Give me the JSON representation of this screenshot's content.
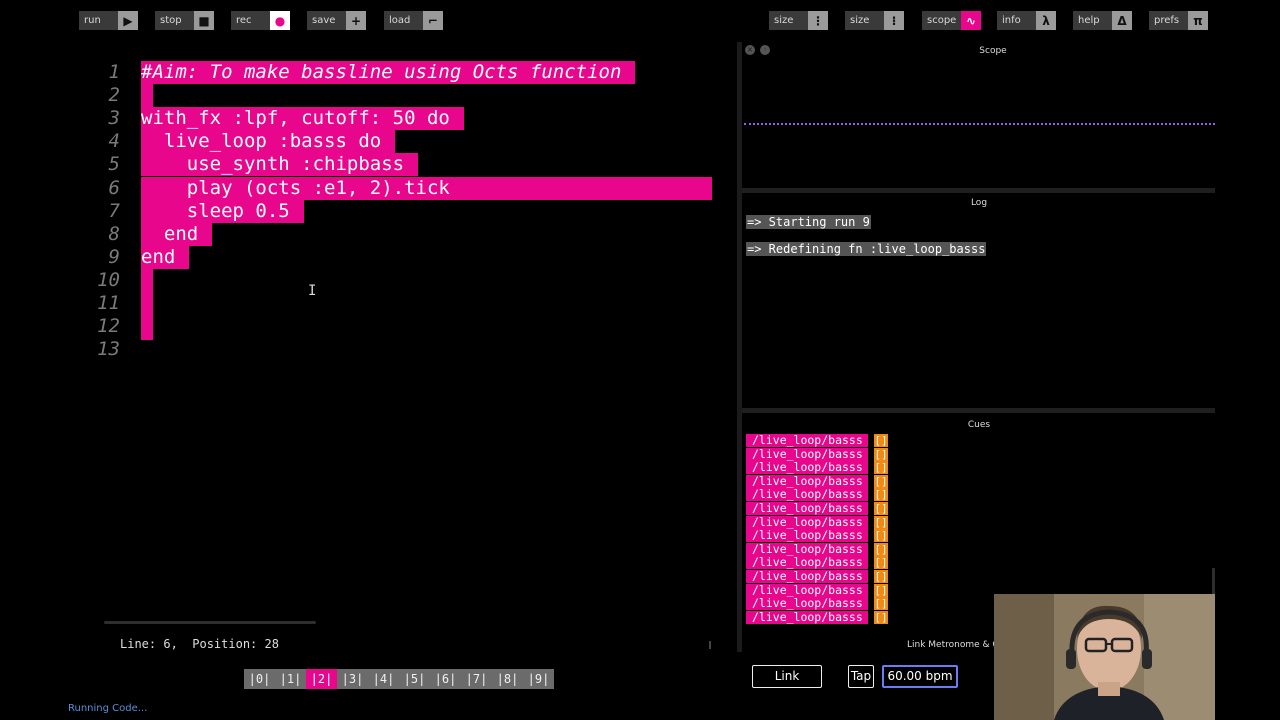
{
  "toolbar": {
    "left": [
      {
        "id": "run",
        "label": "run",
        "icon": "play-icon",
        "glyph": "▶"
      },
      {
        "id": "stop",
        "label": "stop",
        "icon": "stop-icon",
        "glyph": "■"
      },
      {
        "id": "rec",
        "label": "rec",
        "icon": "record-icon",
        "glyph": "●"
      },
      {
        "id": "save",
        "label": "save",
        "icon": "plus-icon",
        "glyph": "+"
      },
      {
        "id": "load",
        "label": "load",
        "icon": "load-icon",
        "glyph": "⌐"
      }
    ],
    "right": [
      {
        "id": "size-down",
        "label": "size",
        "icon": "size-icon",
        "glyph": "⋮"
      },
      {
        "id": "size-up",
        "label": "size",
        "icon": "size-icon",
        "glyph": "⁝"
      },
      {
        "id": "scope",
        "label": "scope",
        "icon": "scope-icon",
        "glyph": "∿"
      },
      {
        "id": "info",
        "label": "info",
        "icon": "lambda-icon",
        "glyph": "λ"
      },
      {
        "id": "help",
        "label": "help",
        "icon": "delta-icon",
        "glyph": "Δ"
      },
      {
        "id": "prefs",
        "label": "prefs",
        "icon": "pi-icon",
        "glyph": "π"
      }
    ]
  },
  "editor": {
    "line_numbers": [
      "1",
      "2",
      "3",
      "4",
      "5",
      "6",
      "7",
      "8",
      "9",
      "10",
      "11",
      "12",
      "13"
    ],
    "lines": [
      "#Aim: To make bassline using Octs function",
      "",
      "with_fx :lpf, cutoff: 50 do",
      "  live_loop :basss do",
      "    use_synth :chipbass",
      "    play (octs :e1, 2).tick",
      "    sleep 0.5",
      "  end",
      "end",
      "",
      "",
      "",
      ""
    ],
    "status": "Line: 6,  Position: 28",
    "buffers": [
      "|0|",
      "|1|",
      "|2|",
      "|3|",
      "|4|",
      "|5|",
      "|6|",
      "|7|",
      "|8|",
      "|9|"
    ],
    "active_buffer": 2,
    "running_text": "Running Code..."
  },
  "scope": {
    "title": "Scope",
    "color": "#9a5cf0"
  },
  "log": {
    "title": "Log",
    "lines": [
      "=> Starting run 9",
      "=> Redefining fn :live_loop_basss"
    ]
  },
  "cues": {
    "title": "Cues",
    "items": [
      {
        "path": "/live_loop/basss",
        "value": "[]"
      },
      {
        "path": "/live_loop/basss",
        "value": "[]"
      },
      {
        "path": "/live_loop/basss",
        "value": "[]"
      },
      {
        "path": "/live_loop/basss",
        "value": "[]"
      },
      {
        "path": "/live_loop/basss",
        "value": "[]"
      },
      {
        "path": "/live_loop/basss",
        "value": "[]"
      },
      {
        "path": "/live_loop/basss",
        "value": "[]"
      },
      {
        "path": "/live_loop/basss",
        "value": "[]"
      },
      {
        "path": "/live_loop/basss",
        "value": "[]"
      },
      {
        "path": "/live_loop/basss",
        "value": "[]"
      },
      {
        "path": "/live_loop/basss",
        "value": "[]"
      },
      {
        "path": "/live_loop/basss",
        "value": "[]"
      },
      {
        "path": "/live_loop/basss",
        "value": "[]"
      },
      {
        "path": "/live_loop/basss",
        "value": "[]"
      }
    ]
  },
  "metronome": {
    "title": "Link Metronome & Glo",
    "link_label": "Link",
    "tap_label": "Tap",
    "bpm": "60.00 bpm"
  },
  "colors": {
    "accent": "#e8068c",
    "cue_value": "#f08a14",
    "bpm_border": "#6b7cf5"
  }
}
